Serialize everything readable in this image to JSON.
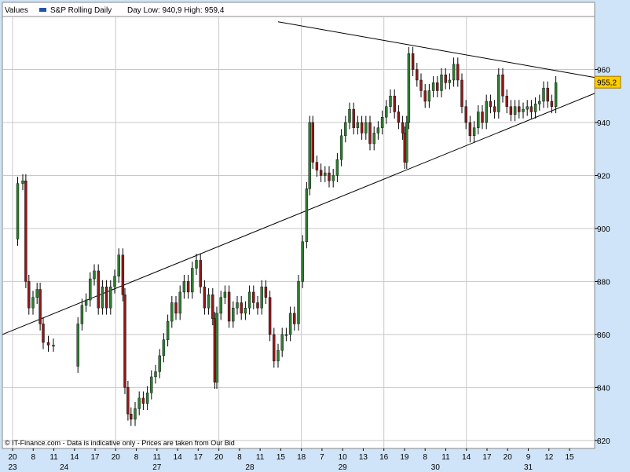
{
  "legend": {
    "title": "Values",
    "series_name": "S&P Rolling Daily",
    "day_stats": "Day Low: 940,9 High: 959,4"
  },
  "copyright": "© IT-Finance.com - Data is indicative only - Prices are taken from Our Bid",
  "last_price_label": "955,2",
  "colors": {
    "background": "#cfe4f8",
    "plot_bg": "#ffffff",
    "grid": "#c8c8c8",
    "up_candle": "#2e7d32",
    "down_candle": "#8b1a1a",
    "price_tag": "#ffcc00",
    "trendline": "#000000",
    "legend_swatch": "#2255aa"
  },
  "chart_data": {
    "type": "line",
    "title": "",
    "series": [
      {
        "name": "S&P Rolling Daily",
        "style": "candlestick-intraday",
        "points": [
          {
            "t": 0.0,
            "v": 896
          },
          {
            "t": 0.5,
            "v": 917
          },
          {
            "t": 1.0,
            "v": 918
          },
          {
            "t": 1.3,
            "v": 880
          },
          {
            "t": 1.6,
            "v": 870
          },
          {
            "t": 2.0,
            "v": 874
          },
          {
            "t": 2.4,
            "v": 877
          },
          {
            "t": 2.7,
            "v": 864
          },
          {
            "t": 3.0,
            "v": 857
          },
          {
            "t": 3.5,
            "v": 856
          },
          {
            "t": 4.0,
            "v": 856
          },
          {
            "t": 6.0,
            "v": 848
          },
          {
            "t": 6.4,
            "v": 864
          },
          {
            "t": 6.8,
            "v": 871
          },
          {
            "t": 7.2,
            "v": 873
          },
          {
            "t": 7.6,
            "v": 881
          },
          {
            "t": 8.0,
            "v": 884
          },
          {
            "t": 8.4,
            "v": 870
          },
          {
            "t": 8.8,
            "v": 878
          },
          {
            "t": 9.2,
            "v": 870
          },
          {
            "t": 9.6,
            "v": 878
          },
          {
            "t": 10.0,
            "v": 882
          },
          {
            "t": 10.4,
            "v": 890
          },
          {
            "t": 10.8,
            "v": 875
          },
          {
            "t": 11.0,
            "v": 840
          },
          {
            "t": 11.3,
            "v": 830
          },
          {
            "t": 11.6,
            "v": 828
          },
          {
            "t": 12.0,
            "v": 832
          },
          {
            "t": 12.4,
            "v": 836
          },
          {
            "t": 12.8,
            "v": 834
          },
          {
            "t": 13.2,
            "v": 838
          },
          {
            "t": 13.6,
            "v": 844
          },
          {
            "t": 14.0,
            "v": 846
          },
          {
            "t": 14.4,
            "v": 852
          },
          {
            "t": 14.8,
            "v": 858
          },
          {
            "t": 15.2,
            "v": 865
          },
          {
            "t": 15.6,
            "v": 872
          },
          {
            "t": 16.0,
            "v": 868
          },
          {
            "t": 16.4,
            "v": 876
          },
          {
            "t": 16.8,
            "v": 880
          },
          {
            "t": 17.2,
            "v": 876
          },
          {
            "t": 17.6,
            "v": 885
          },
          {
            "t": 18.0,
            "v": 888
          },
          {
            "t": 18.4,
            "v": 878
          },
          {
            "t": 18.8,
            "v": 870
          },
          {
            "t": 19.2,
            "v": 875
          },
          {
            "t": 19.6,
            "v": 866
          },
          {
            "t": 19.8,
            "v": 842
          },
          {
            "t": 20.0,
            "v": 868
          },
          {
            "t": 20.4,
            "v": 874
          },
          {
            "t": 20.8,
            "v": 876
          },
          {
            "t": 21.2,
            "v": 865
          },
          {
            "t": 21.6,
            "v": 870
          },
          {
            "t": 22.0,
            "v": 872
          },
          {
            "t": 22.4,
            "v": 868
          },
          {
            "t": 22.8,
            "v": 870
          },
          {
            "t": 23.2,
            "v": 876
          },
          {
            "t": 23.6,
            "v": 872
          },
          {
            "t": 24.0,
            "v": 870
          },
          {
            "t": 24.4,
            "v": 878
          },
          {
            "t": 24.8,
            "v": 874
          },
          {
            "t": 25.2,
            "v": 860
          },
          {
            "t": 25.6,
            "v": 850
          },
          {
            "t": 26.0,
            "v": 854
          },
          {
            "t": 26.4,
            "v": 860
          },
          {
            "t": 26.8,
            "v": 860
          },
          {
            "t": 27.2,
            "v": 868
          },
          {
            "t": 27.6,
            "v": 864
          },
          {
            "t": 28.0,
            "v": 880
          },
          {
            "t": 28.4,
            "v": 895
          },
          {
            "t": 28.8,
            "v": 915
          },
          {
            "t": 29.1,
            "v": 940
          },
          {
            "t": 29.4,
            "v": 925
          },
          {
            "t": 29.8,
            "v": 922
          },
          {
            "t": 30.2,
            "v": 920
          },
          {
            "t": 30.6,
            "v": 921
          },
          {
            "t": 31.0,
            "v": 918
          },
          {
            "t": 31.4,
            "v": 920
          },
          {
            "t": 31.8,
            "v": 926
          },
          {
            "t": 32.2,
            "v": 935
          },
          {
            "t": 32.6,
            "v": 940
          },
          {
            "t": 33.0,
            "v": 945
          },
          {
            "t": 33.4,
            "v": 938
          },
          {
            "t": 33.8,
            "v": 940
          },
          {
            "t": 34.2,
            "v": 936
          },
          {
            "t": 34.6,
            "v": 940
          },
          {
            "t": 35.0,
            "v": 932
          },
          {
            "t": 35.4,
            "v": 936
          },
          {
            "t": 35.8,
            "v": 938
          },
          {
            "t": 36.2,
            "v": 942
          },
          {
            "t": 36.6,
            "v": 946
          },
          {
            "t": 37.0,
            "v": 950
          },
          {
            "t": 37.4,
            "v": 944
          },
          {
            "t": 37.8,
            "v": 940
          },
          {
            "t": 38.2,
            "v": 936
          },
          {
            "t": 38.4,
            "v": 925
          },
          {
            "t": 38.6,
            "v": 940
          },
          {
            "t": 38.8,
            "v": 966
          },
          {
            "t": 39.2,
            "v": 960
          },
          {
            "t": 39.6,
            "v": 956
          },
          {
            "t": 40.0,
            "v": 952
          },
          {
            "t": 40.4,
            "v": 948
          },
          {
            "t": 40.8,
            "v": 952
          },
          {
            "t": 41.2,
            "v": 955
          },
          {
            "t": 41.6,
            "v": 952
          },
          {
            "t": 42.0,
            "v": 958
          },
          {
            "t": 42.4,
            "v": 955
          },
          {
            "t": 42.8,
            "v": 956
          },
          {
            "t": 43.2,
            "v": 962
          },
          {
            "t": 43.6,
            "v": 956
          },
          {
            "t": 44.0,
            "v": 946
          },
          {
            "t": 44.4,
            "v": 940
          },
          {
            "t": 44.8,
            "v": 935
          },
          {
            "t": 45.2,
            "v": 938
          },
          {
            "t": 45.6,
            "v": 944
          },
          {
            "t": 46.0,
            "v": 940
          },
          {
            "t": 46.4,
            "v": 948
          },
          {
            "t": 46.8,
            "v": 946
          },
          {
            "t": 47.2,
            "v": 944
          },
          {
            "t": 47.6,
            "v": 958
          },
          {
            "t": 48.0,
            "v": 950
          },
          {
            "t": 48.4,
            "v": 946
          },
          {
            "t": 48.8,
            "v": 943
          },
          {
            "t": 49.2,
            "v": 946
          },
          {
            "t": 49.6,
            "v": 944
          },
          {
            "t": 50.0,
            "v": 945
          },
          {
            "t": 50.4,
            "v": 946
          },
          {
            "t": 50.8,
            "v": 944
          },
          {
            "t": 51.2,
            "v": 947
          },
          {
            "t": 51.6,
            "v": 948
          },
          {
            "t": 52.0,
            "v": 953
          },
          {
            "t": 52.4,
            "v": 948
          },
          {
            "t": 52.8,
            "v": 946
          },
          {
            "t": 53.2,
            "v": 955
          }
        ]
      }
    ],
    "trendlines": [
      {
        "name": "upper",
        "from": {
          "t": 26.0,
          "v": 978
        },
        "to": {
          "t": 57.0,
          "v": 957
        }
      },
      {
        "name": "lower",
        "from": {
          "t": -1.0,
          "v": 860
        },
        "to": {
          "t": 57.0,
          "v": 951
        }
      }
    ],
    "x_ticks": [
      "20",
      "8",
      "11",
      "14",
      "17",
      "20",
      "8",
      "11",
      "14",
      "17",
      "20",
      "8",
      "11",
      "15",
      "18",
      "7",
      "10",
      "13",
      "16",
      "19",
      "8",
      "11",
      "14",
      "17",
      "20",
      "9",
      "12",
      "15"
    ],
    "x_day_labels": [
      {
        "label": "23",
        "tick_index": 0
      },
      {
        "label": "24",
        "tick_index": 2.5
      },
      {
        "label": "27",
        "tick_index": 7.0
      },
      {
        "label": "28",
        "tick_index": 11.5
      },
      {
        "label": "29",
        "tick_index": 16.0
      },
      {
        "label": "30",
        "tick_index": 20.5
      },
      {
        "label": "31",
        "tick_index": 25.0
      }
    ],
    "x_tick_spacing": 2.02,
    "y_ticks": [
      820,
      840,
      860,
      880,
      900,
      920,
      940,
      960
    ],
    "ylim": [
      817,
      980
    ],
    "xlim": [
      -1.0,
      57.0
    ],
    "day_separators_tick_index": [
      0,
      5,
      10,
      14,
      18,
      22
    ],
    "grid": true,
    "legend_position": "top-left",
    "last_value": 955.2
  }
}
